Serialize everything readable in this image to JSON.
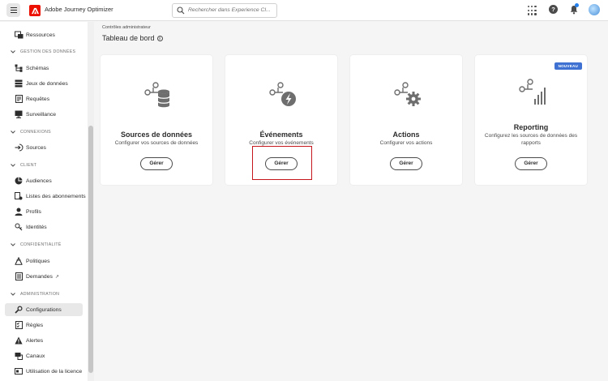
{
  "header": {
    "app_title": "Adobe Journey Optimizer",
    "search_placeholder": "Rechercher dans Experience Cl..."
  },
  "sidebar": {
    "items": [
      {
        "id": "ressources",
        "label": "Ressources",
        "icon": "resources-icon"
      },
      {
        "section": "GESTION DES DONNÉES"
      },
      {
        "id": "schemas",
        "label": "Schémas",
        "icon": "schema-icon"
      },
      {
        "id": "jeux",
        "label": "Jeux de données",
        "icon": "datasets-icon"
      },
      {
        "id": "requetes",
        "label": "Requêtes",
        "icon": "queries-icon"
      },
      {
        "id": "surveillance",
        "label": "Surveillance",
        "icon": "monitoring-icon"
      },
      {
        "section": "CONNEXIONS"
      },
      {
        "id": "sources",
        "label": "Sources",
        "icon": "sources-icon"
      },
      {
        "section": "CLIENT"
      },
      {
        "id": "audiences",
        "label": "Audiences",
        "icon": "audiences-icon"
      },
      {
        "id": "listes",
        "label": "Listes des abonnements",
        "icon": "subscription-list-icon"
      },
      {
        "id": "profils",
        "label": "Profils",
        "icon": "profiles-icon"
      },
      {
        "id": "identites",
        "label": "Identités",
        "icon": "identities-icon"
      },
      {
        "section": "CONFIDENTIALITÉ"
      },
      {
        "id": "politiques",
        "label": "Politiques",
        "icon": "policies-icon"
      },
      {
        "id": "demandes",
        "label": "Demandes",
        "icon": "requests-icon"
      },
      {
        "section": "ADMINISTRATION"
      },
      {
        "id": "configurations",
        "label": "Configurations",
        "icon": "configurations-icon",
        "active": true
      },
      {
        "id": "regles",
        "label": "Règles",
        "icon": "rules-icon"
      },
      {
        "id": "alertes",
        "label": "Alertes",
        "icon": "alerts-icon"
      },
      {
        "id": "canaux",
        "label": "Canaux",
        "icon": "channels-icon"
      },
      {
        "id": "licence",
        "label": "Utilisation de la licence",
        "icon": "license-icon"
      }
    ]
  },
  "main": {
    "breadcrumb": "Contrôles administrateur",
    "title": "Tableau de bord",
    "cards": [
      {
        "title": "Sources de données",
        "description": "Configurer vos sources de données",
        "button": "Gérer",
        "icon": "data-sources-icon"
      },
      {
        "title": "Événements",
        "description": "Configurer vos événements",
        "button": "Gérer",
        "icon": "events-icon"
      },
      {
        "title": "Actions",
        "description": "Configurer vos actions",
        "button": "Gérer",
        "icon": "actions-icon"
      },
      {
        "title": "Reporting",
        "description": "Configurez les sources de données des rapports",
        "button": "Gérer",
        "icon": "reporting-icon",
        "badge": "NOUVEAU"
      }
    ]
  },
  "colors": {
    "brand": "#eb1000",
    "badge": "#3e71d1",
    "highlight": "#c4161c",
    "notification": "#2680eb"
  }
}
